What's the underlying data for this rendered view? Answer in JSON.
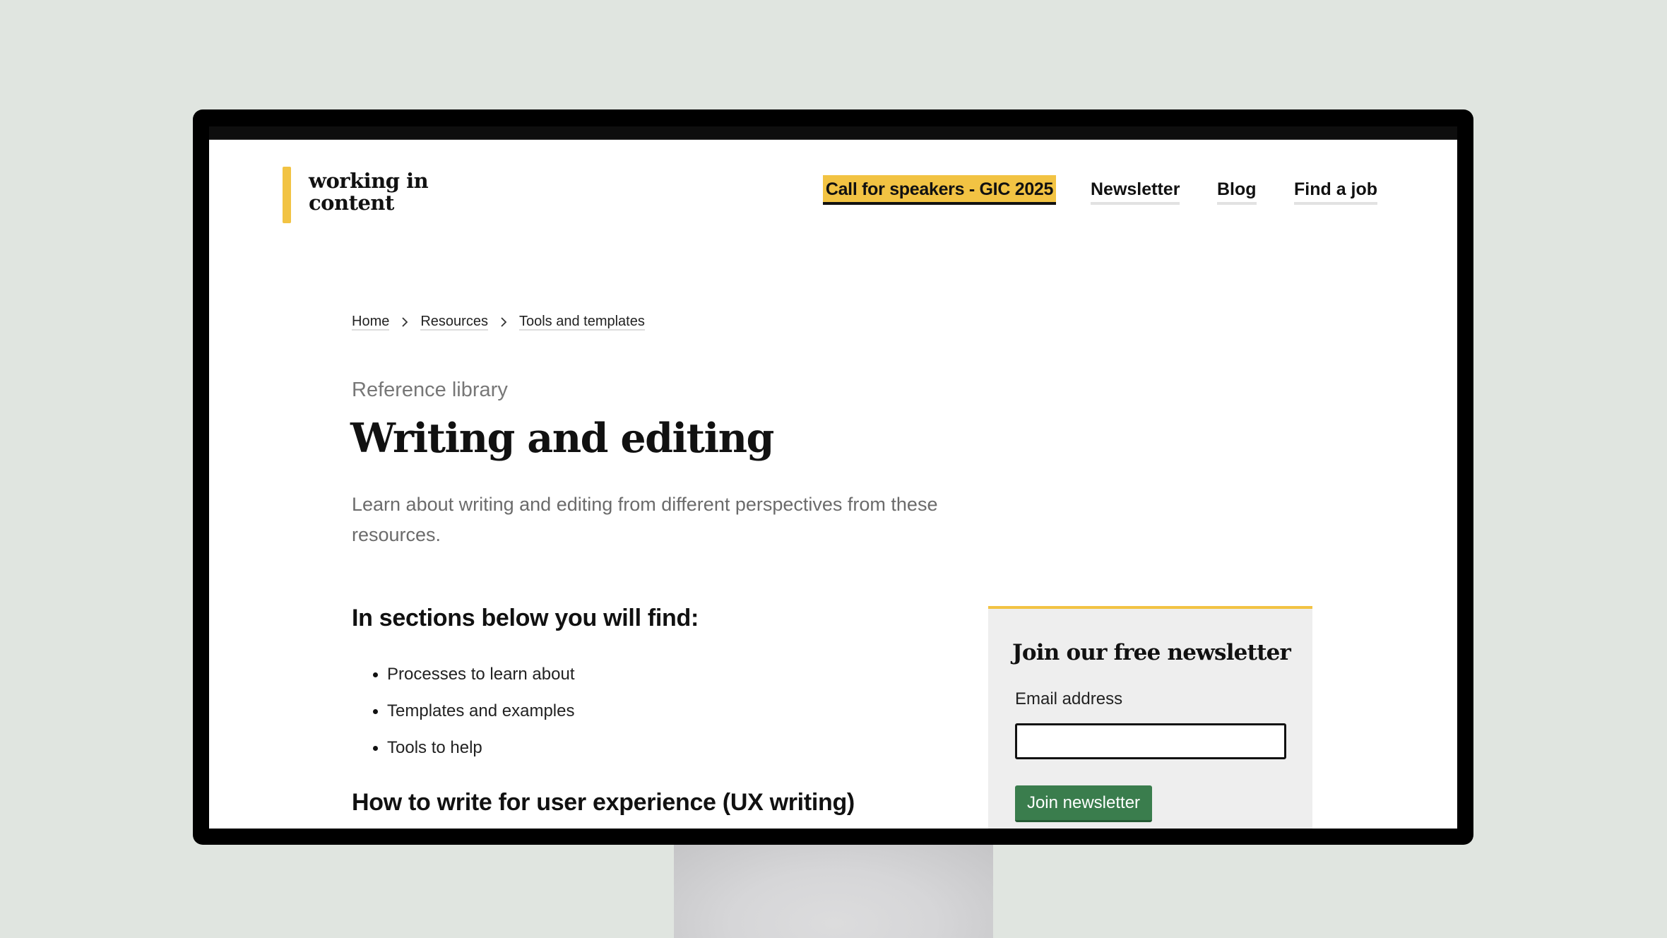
{
  "colors": {
    "background": "#e0e5e0",
    "accent_yellow": "#f2c343",
    "button_green": "#3a7d4d",
    "text_dark": "#111111",
    "text_muted": "#6b6b6b"
  },
  "logo": {
    "line1": "working in",
    "line2": "content"
  },
  "nav": {
    "items": [
      {
        "label": "Call for speakers - GIC 2025",
        "highlighted": true
      },
      {
        "label": "Newsletter",
        "highlighted": false
      },
      {
        "label": "Blog",
        "highlighted": false
      },
      {
        "label": "Find a job",
        "highlighted": false
      }
    ]
  },
  "breadcrumb": {
    "items": [
      "Home",
      "Resources",
      "Tools and templates"
    ],
    "separator_icon": "chevron-right-icon"
  },
  "page": {
    "eyebrow": "Reference library",
    "title": "Writing and editing",
    "lead": "Learn about writing and editing from different perspectives from these resources."
  },
  "sections": {
    "find_heading": "In sections below you will find:",
    "find_items": [
      "Processes to learn about",
      "Templates and examples",
      "Tools to help"
    ],
    "next_heading": "How to write for user experience (UX writing)"
  },
  "newsletter": {
    "title": "Join our free newsletter",
    "email_label": "Email address",
    "email_value": "",
    "button_label": "Join newsletter"
  }
}
